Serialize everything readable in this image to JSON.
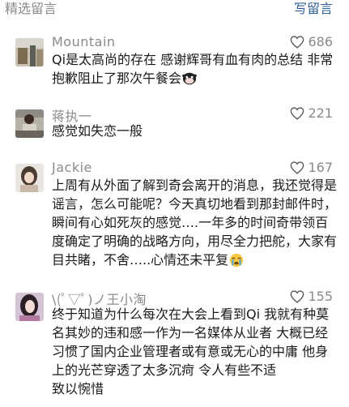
{
  "header": {
    "title": "精选留言",
    "write": "写留言"
  },
  "comments": [
    {
      "name": "Mountain",
      "likes": "686",
      "text": "Qi是太高尚的存在 感谢辉哥有血有肉的总结 非常抱歉阻止了那次午餐会",
      "emoji": "cow-face-emoji"
    },
    {
      "name": "蒋执一",
      "likes": "221",
      "text": "感觉如失恋一般"
    },
    {
      "name": "Jackie",
      "likes": "167",
      "text": "上周有从外面了解到奇会离开的消息，我还觉得是谣言，怎么可能呢？今天真切地看到那封邮件时，瞬间有心如死灰的感觉….一年多的时间奇带领百度确定了明确的战略方向，用尽全力把舵，大家有目共睹，不舍…..心情还未平复",
      "emoji": "crying-face-emoji"
    },
    {
      "name": "\\(ﾟ▽ﾟ)ノ王小淘",
      "likes": "155",
      "text": "终于知道为什么每次在大会上看到Qi 我就有种莫名其妙的违和感一作为一名媒体从业者 大概已经习惯了国内企业管理者或有意或无心的中庸 他身上的光芒穿透了太多沉疴 令人有些不适\n致以惋惜"
    }
  ],
  "colors": {
    "name": "#8a8a8a",
    "text": "#1a1a1a",
    "link": "#2f5f92"
  },
  "icons": {
    "like": "heart-outline-icon"
  }
}
